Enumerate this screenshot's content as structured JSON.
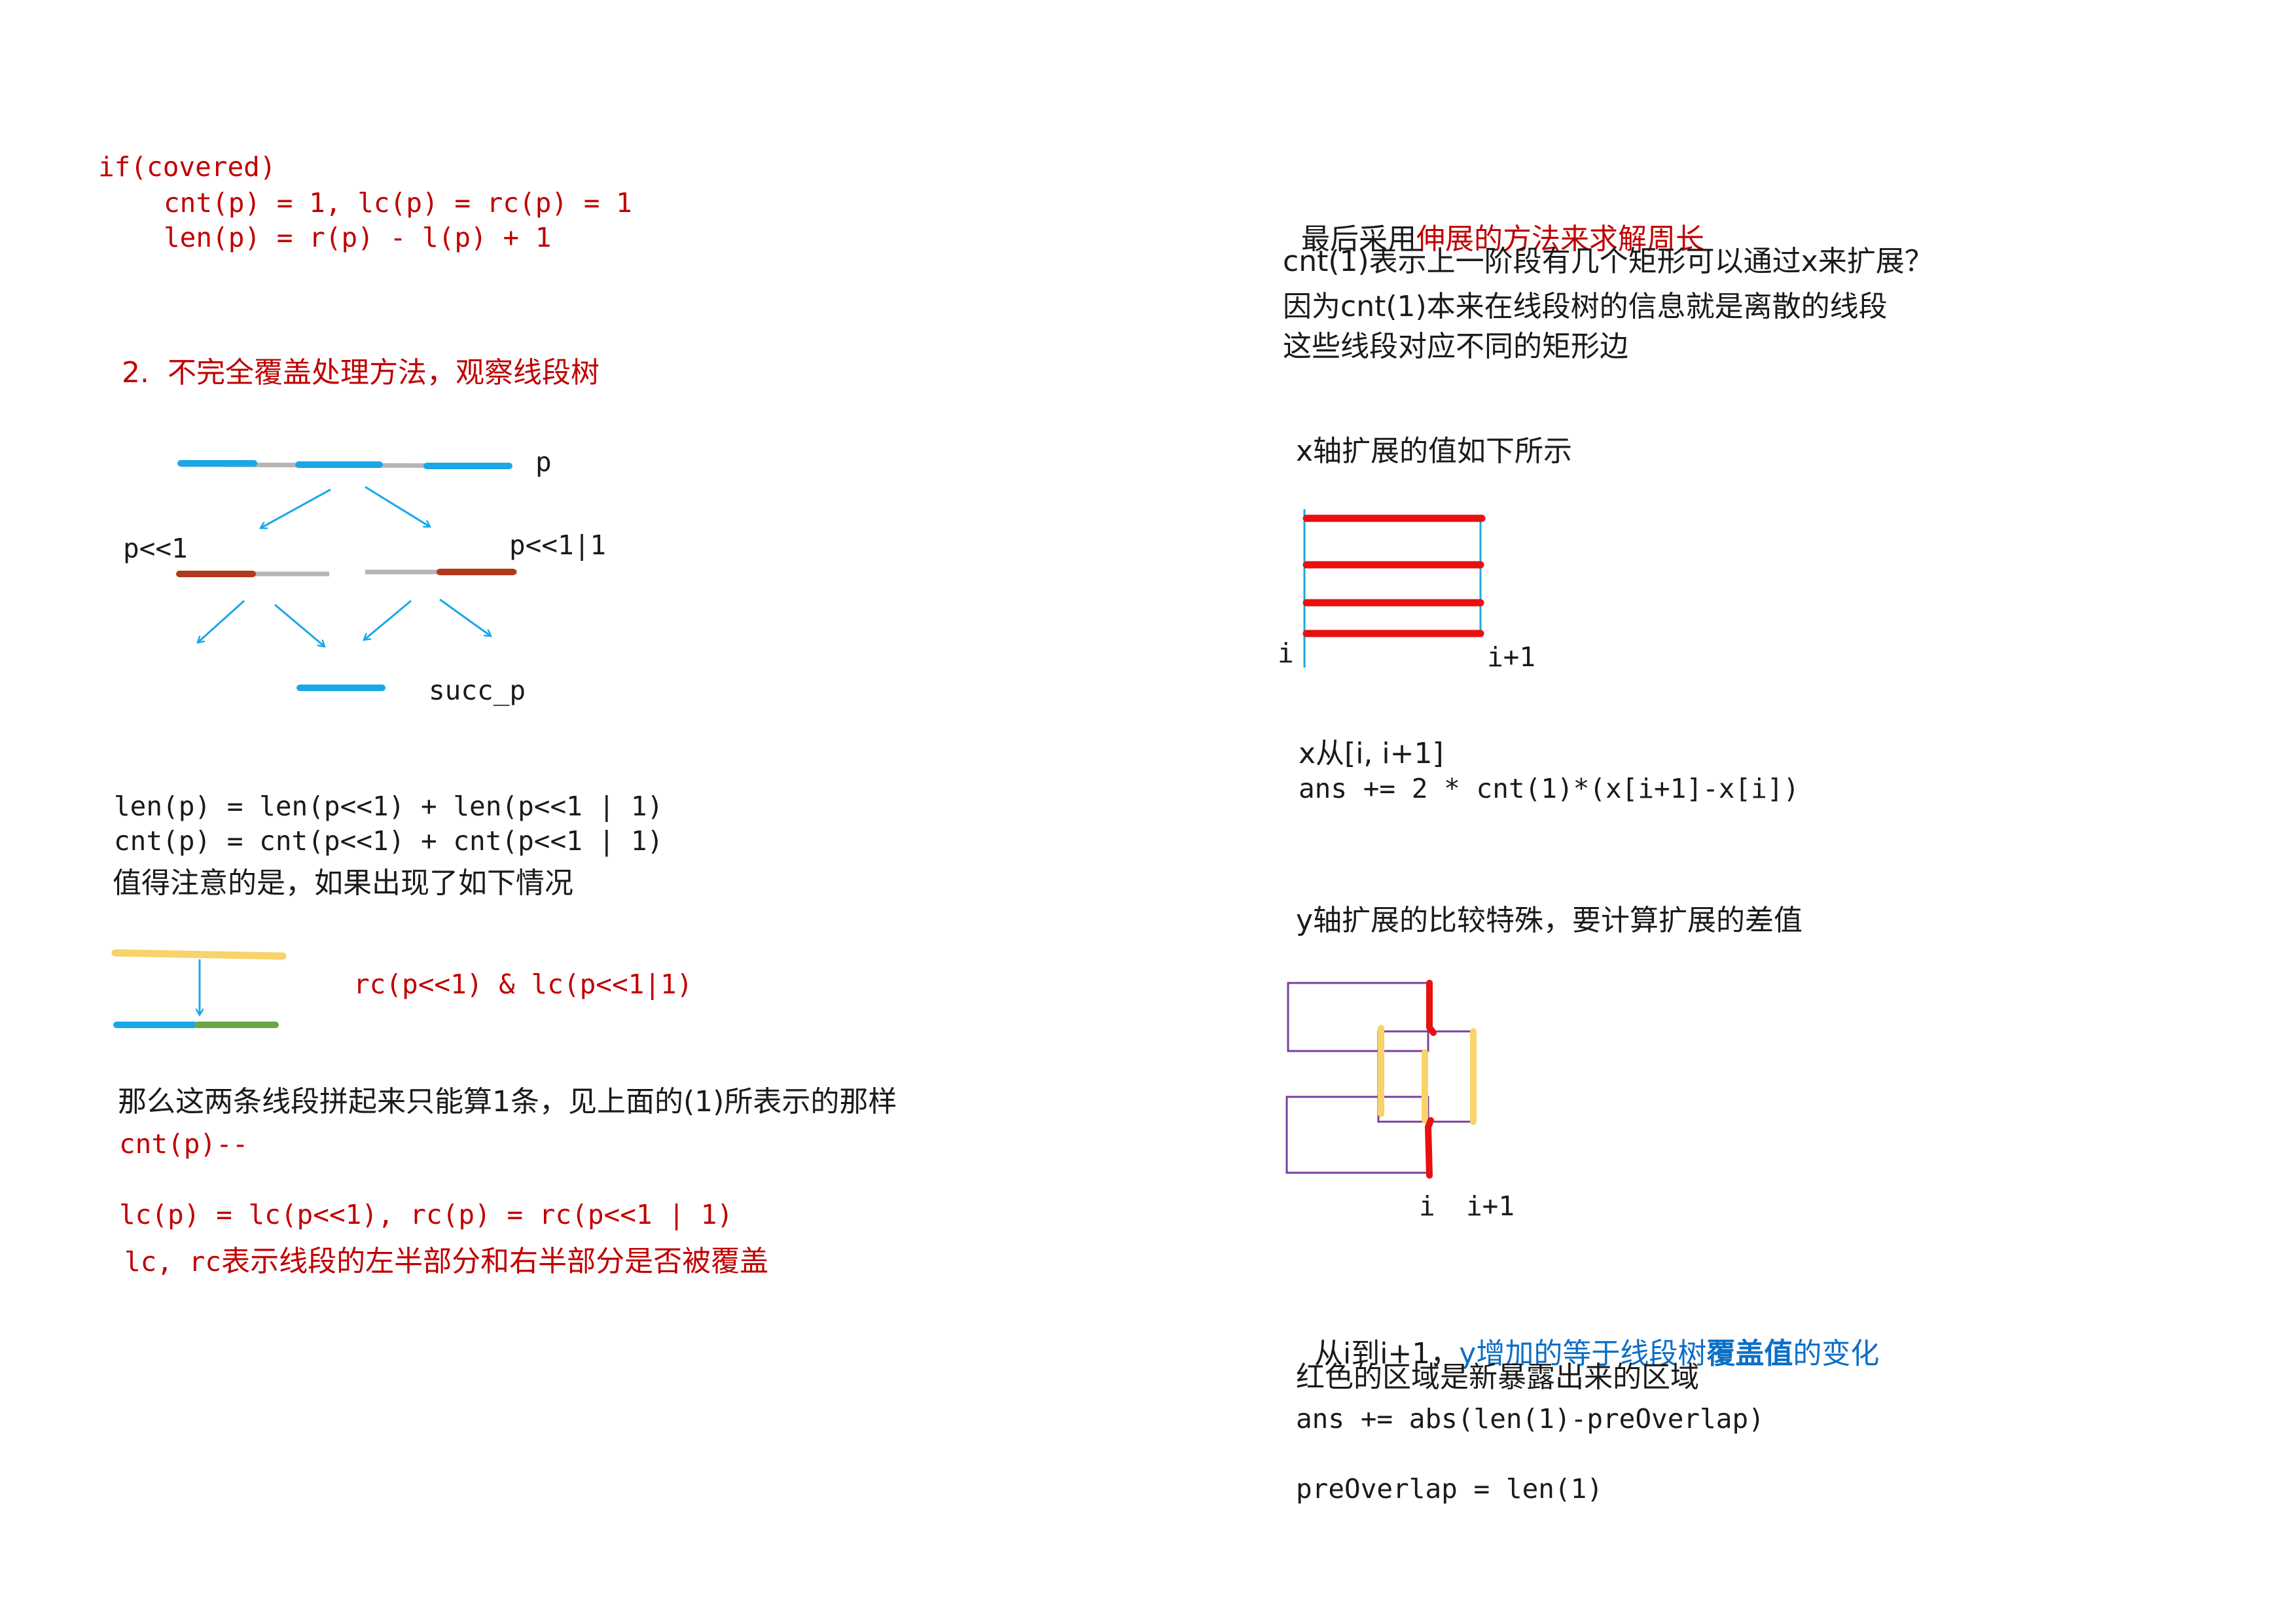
{
  "left": {
    "covered": {
      "line1": "if(covered)",
      "line2": "cnt(p) = 1, lc(p) = rc(p) = 1",
      "line3": "len(p) = r(p) - l(p) + 1"
    },
    "section2_title": "2.  不完全覆盖处理方法，观察线段树",
    "tree": {
      "label_p": "p",
      "label_left": "p<<1",
      "label_right": "p<<1|1",
      "label_succ": "succ_p"
    },
    "formulas": {
      "len": "len(p) = len(p<<1) + len(p<<1 | 1)",
      "cnt": "cnt(p) = cnt(p<<1) + cnt(p<<1 | 1)",
      "note": "值得注意的是，如果出现了如下情况"
    },
    "merge": {
      "condition": "rc(p<<1) & lc(p<<1|1)",
      "explain": "那么这两条线段拼起来只能算1条，见上面的(1)所表示的那样",
      "decrement": "cnt(p)--",
      "assign": "lc(p) = lc(p<<1), rc(p) = rc(p<<1 | 1)",
      "meaning_prefix": "lc, rc",
      "meaning_text": "表示线段的左半部分和右半部分是否被覆盖"
    }
  },
  "right": {
    "intro": {
      "prefix": "最后采用",
      "highlight": "伸展的方法来求解周长",
      "line2": "cnt(1)表示上一阶段有几个矩形可以通过x来扩展？",
      "line3": "因为cnt(1)本来在线段树的信息就是离散的线段",
      "line4": "这些线段对应不同的矩形边"
    },
    "x_section": {
      "title": "x轴扩展的值如下所示",
      "label_i": "i",
      "label_i1": "i+1",
      "range": "x从[i, i+1]",
      "formula": "ans += 2 * cnt(1)*(x[i+1]-x[i])"
    },
    "y_section": {
      "title": "y轴扩展的比较特殊，要计算扩展的差值",
      "label_i": "i",
      "label_i1": "i+1",
      "line1_prefix": "从i到i+1，",
      "line1_blue": "y增加的等于线段树",
      "line1_bold": "覆盖值",
      "line1_end": "的变化",
      "line2": "红色的区域是新暴露出来的区域",
      "formula": "ans += abs(len(1)-preOverlap)",
      "assign": "preOverlap = len(1)"
    }
  },
  "colors": {
    "red": "#c00000",
    "blue_text": "#0b6fc7",
    "segment_blue": "#1aa7e8",
    "segment_gray": "#b5b5b5",
    "segment_brown": "#b03a1c",
    "segment_yellow": "#f7d36a",
    "segment_green": "#6aa843",
    "rect_purple": "#7a3fa0",
    "bright_red": "#e81010"
  }
}
